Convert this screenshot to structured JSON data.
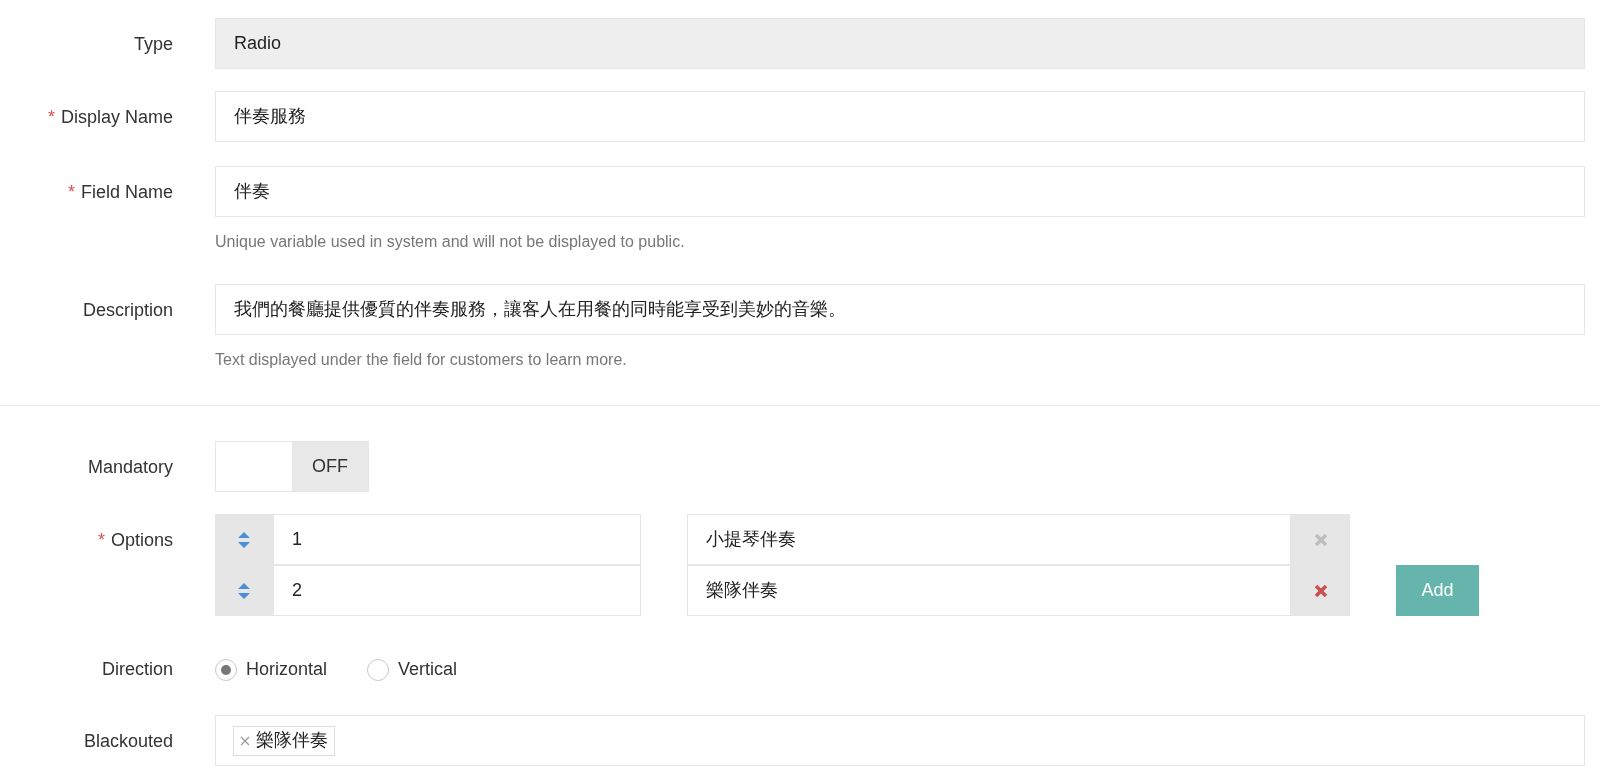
{
  "type_field": {
    "label": "Type",
    "value": "Radio",
    "disabled": true
  },
  "display_name": {
    "label": "Display Name",
    "required_mark": "*",
    "value": "伴奏服務"
  },
  "field_name": {
    "label": "Field Name",
    "required_mark": "*",
    "value": "伴奏",
    "hint": "Unique variable used in system and will not be displayed to public."
  },
  "description": {
    "label": "Description",
    "value": "我們的餐廳提供優質的伴奏服務，讓客人在用餐的同時能享受到美妙的音樂。",
    "hint": "Text displayed under the field for customers to learn more."
  },
  "mandatory": {
    "label": "Mandatory",
    "on": false,
    "state_text": "OFF"
  },
  "options": {
    "label": "Options",
    "required_mark": "*",
    "items": [
      {
        "value": "1",
        "text": "小提琴伴奏",
        "removable": false
      },
      {
        "value": "2",
        "text": "樂隊伴奏",
        "removable": true
      }
    ],
    "add_button": "Add"
  },
  "direction": {
    "label": "Direction",
    "choices": [
      {
        "label": "Horizontal",
        "selected": true
      },
      {
        "label": "Vertical",
        "selected": false
      }
    ]
  },
  "blackouted": {
    "label": "Blackouted",
    "tags": [
      "樂隊伴奏"
    ]
  }
}
